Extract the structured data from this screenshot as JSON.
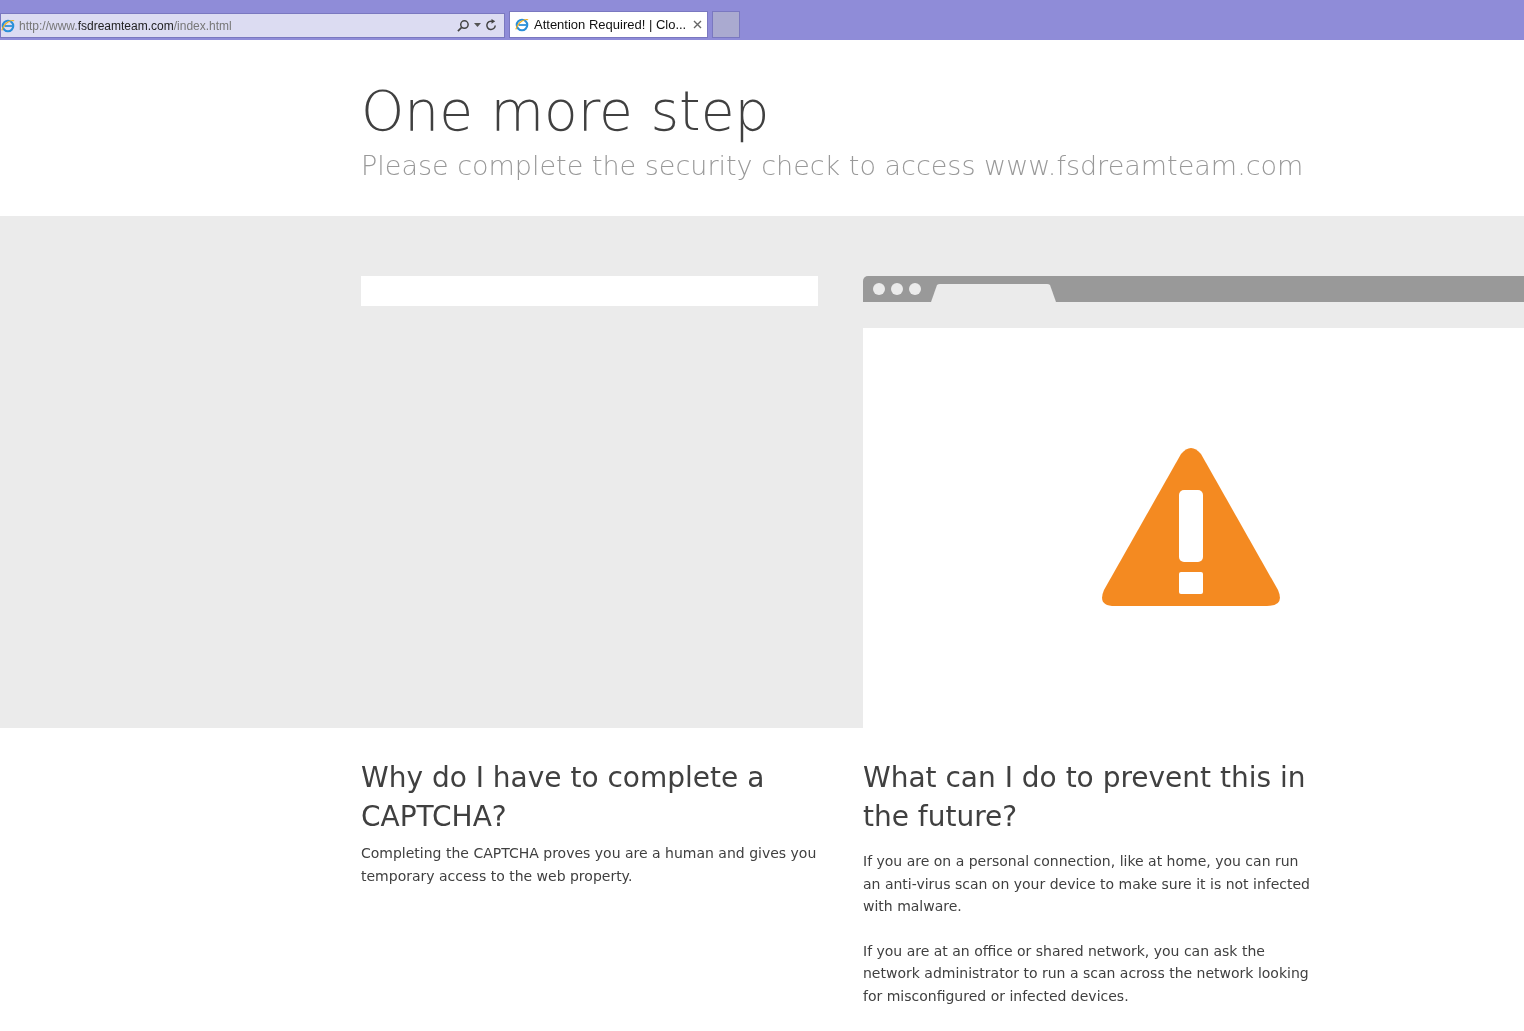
{
  "browser": {
    "address": {
      "prefix": "http://www.",
      "domain": "fsdreamteam.com",
      "path": "/index.html"
    },
    "tabs": [
      {
        "title": "Attention Required! | Clo...",
        "selected": true
      }
    ]
  },
  "header": {
    "title": "One more step",
    "subtitle": "Please complete the security check to access www.fsdreamteam.com"
  },
  "sections": [
    {
      "heading": "Why do I have to complete a CAPTCHA?",
      "paragraphs": [
        "Completing the CAPTCHA proves you are a human and gives you temporary access to the web property."
      ]
    },
    {
      "heading": "What can I do to prevent this in the future?",
      "paragraphs": [
        "If you are on a personal connection, like at home, you can run an anti-virus scan on your device to make sure it is not infected with malware.",
        "If you are at an office or shared network, you can ask the network administrator to run a scan across the network looking for misconfigured or infected devices."
      ]
    }
  ]
}
